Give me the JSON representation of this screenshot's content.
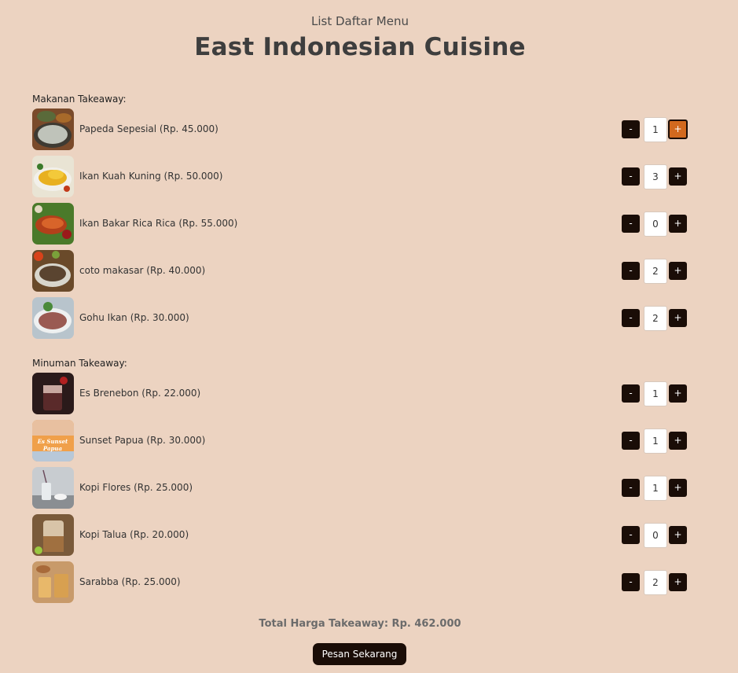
{
  "header": {
    "subtitle": "List Daftar Menu",
    "title": "East Indonesian Cuisine"
  },
  "sections": {
    "food": {
      "label": "Makanan Takeaway:",
      "items": [
        {
          "name": "Papeda Sepesial (Rp. 45.000)",
          "qty": "1",
          "minus": "-",
          "plus": "+"
        },
        {
          "name": "Ikan Kuah Kuning (Rp. 50.000)",
          "qty": "3",
          "minus": "-",
          "plus": "+"
        },
        {
          "name": "Ikan Bakar Rica Rica (Rp. 55.000)",
          "qty": "0",
          "minus": "-",
          "plus": "+"
        },
        {
          "name": "coto makasar (Rp. 40.000)",
          "qty": "2",
          "minus": "-",
          "plus": "+"
        },
        {
          "name": "Gohu Ikan (Rp. 30.000)",
          "qty": "2",
          "minus": "-",
          "plus": "+"
        }
      ]
    },
    "drinks": {
      "label": "Minuman Takeaway:",
      "items": [
        {
          "name": "Es Brenebon (Rp. 22.000)",
          "qty": "1",
          "minus": "-",
          "plus": "+"
        },
        {
          "name": "Sunset Papua (Rp. 30.000)",
          "qty": "1",
          "minus": "-",
          "plus": "+",
          "thumb_text": [
            "Es Sunset",
            "Papua"
          ]
        },
        {
          "name": "Kopi Flores (Rp. 25.000)",
          "qty": "1",
          "minus": "-",
          "plus": "+"
        },
        {
          "name": "Kopi Talua (Rp. 20.000)",
          "qty": "0",
          "minus": "-",
          "plus": "+"
        },
        {
          "name": "Sarabba (Rp. 25.000)",
          "qty": "2",
          "minus": "-",
          "plus": "+"
        }
      ]
    }
  },
  "total": {
    "text": "Total Harga Takeaway: Rp. 462.000"
  },
  "order_button": {
    "label": "Pesan Sekarang"
  },
  "colors": {
    "background": "#ecd3c1",
    "button_dark": "#1a0d07",
    "button_active": "#d2691e"
  }
}
